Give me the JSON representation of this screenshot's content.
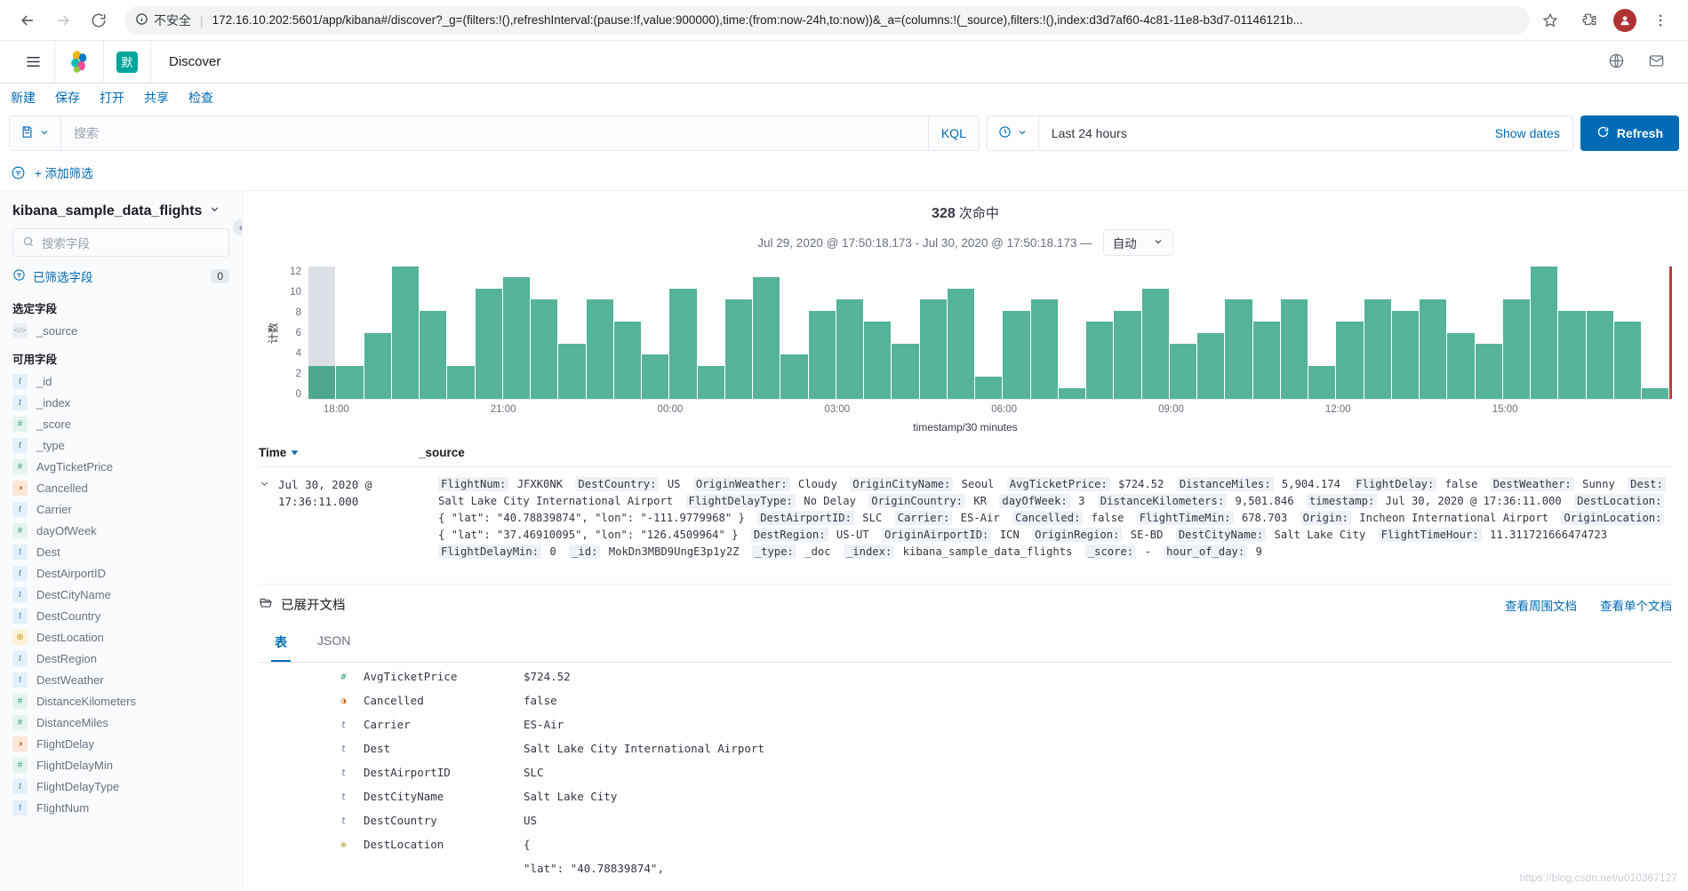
{
  "browser": {
    "security_label": "不安全",
    "url": "172.16.10.202:5601/app/kibana#/discover?_g=(filters:!(),refreshInterval:(pause:!f,value:900000),time:(from:now-24h,to:now))&_a=(columns:!(_source),filters:!(),index:d3d7af60-4c81-11e8-b3d7-01146121b...",
    "back_icon": "back-arrow-icon",
    "forward_icon": "forward-arrow-icon",
    "reload_icon": "reload-icon",
    "info_icon": "info-circle-icon",
    "star_icon": "bookmark-star-icon",
    "extensions_icon": "extensions-icon",
    "menu_icon": "browser-menu-icon"
  },
  "header": {
    "menu_icon": "hamburger-menu-icon",
    "logo_icon": "elastic-logo-icon",
    "space_badge": "默",
    "app_title": "Discover",
    "help_icon": "help-globe-icon",
    "mail_icon": "mail-icon"
  },
  "top_menu": {
    "items": [
      {
        "label": "新建",
        "name": "new-link"
      },
      {
        "label": "保存",
        "name": "save-link"
      },
      {
        "label": "打开",
        "name": "open-link"
      },
      {
        "label": "共享",
        "name": "share-link"
      },
      {
        "label": "检查",
        "name": "inspect-link"
      }
    ]
  },
  "query_bar": {
    "saved_query_icon": "saved-query-icon",
    "chevron_icon": "chevron-down-icon",
    "search_placeholder": "搜索",
    "search_value": "",
    "language": "KQL",
    "clock_icon": "clock-icon",
    "date_range": "Last 24 hours",
    "show_dates": "Show dates",
    "refresh_label": "Refresh",
    "refresh_icon": "refresh-icon",
    "accent_color": "#006bb4"
  },
  "filter_bar": {
    "filter_icon": "filter-funnel-icon",
    "add_filter": "+ 添加筛选"
  },
  "sidebar": {
    "index_pattern": "kibana_sample_data_flights",
    "index_chevron_icon": "chevron-down-icon",
    "field_search_placeholder": "搜索字段",
    "field_search_icon": "search-icon",
    "filtered_fields_label": "已筛选字段",
    "filtered_fields_icon": "filter-funnel-icon",
    "filtered_fields_count": "0",
    "selected_fields_title": "选定字段",
    "available_fields_title": "可用字段",
    "collapse_icon": "collapse-left-icon",
    "selected_fields": [
      {
        "name": "_source",
        "type": "src",
        "glyph": "</>"
      }
    ],
    "available_fields": [
      {
        "name": "_id",
        "type": "string",
        "glyph": "t"
      },
      {
        "name": "_index",
        "type": "string",
        "glyph": "t"
      },
      {
        "name": "_score",
        "type": "number",
        "glyph": "#"
      },
      {
        "name": "_type",
        "type": "string",
        "glyph": "t"
      },
      {
        "name": "AvgTicketPrice",
        "type": "number",
        "glyph": "#"
      },
      {
        "name": "Cancelled",
        "type": "bool",
        "glyph": "◑"
      },
      {
        "name": "Carrier",
        "type": "string",
        "glyph": "t"
      },
      {
        "name": "dayOfWeek",
        "type": "number",
        "glyph": "#"
      },
      {
        "name": "Dest",
        "type": "string",
        "glyph": "t"
      },
      {
        "name": "DestAirportID",
        "type": "string",
        "glyph": "t"
      },
      {
        "name": "DestCityName",
        "type": "string",
        "glyph": "t"
      },
      {
        "name": "DestCountry",
        "type": "string",
        "glyph": "t"
      },
      {
        "name": "DestLocation",
        "type": "geo",
        "glyph": "⊕"
      },
      {
        "name": "DestRegion",
        "type": "string",
        "glyph": "t"
      },
      {
        "name": "DestWeather",
        "type": "string",
        "glyph": "t"
      },
      {
        "name": "DistanceKilometers",
        "type": "number",
        "glyph": "#"
      },
      {
        "name": "DistanceMiles",
        "type": "number",
        "glyph": "#"
      },
      {
        "name": "FlightDelay",
        "type": "bool",
        "glyph": "◑"
      },
      {
        "name": "FlightDelayMin",
        "type": "number",
        "glyph": "#"
      },
      {
        "name": "FlightDelayType",
        "type": "string",
        "glyph": "t"
      },
      {
        "name": "FlightNum",
        "type": "string",
        "glyph": "t"
      }
    ]
  },
  "results": {
    "hits_count": "328",
    "hits_label": "次命中",
    "time_range_text": "Jul 29, 2020 @ 17:50:18.173 - Jul 30, 2020 @ 17:50:18.173 —",
    "interval_value": "自动",
    "interval_chevron_icon": "chevron-down-icon"
  },
  "chart_data": {
    "type": "bar",
    "title": "",
    "xlabel": "timestamp/30 minutes",
    "ylabel": "计数",
    "ylim": [
      0,
      12
    ],
    "yticks": [
      12,
      10,
      8,
      6,
      4,
      2,
      0
    ],
    "xticks": [
      "18:00",
      "21:00",
      "00:00",
      "03:00",
      "06:00",
      "09:00",
      "12:00",
      "15:00"
    ],
    "grid": false,
    "legend": "none",
    "bar_color": "#54b399",
    "highlight_color": "#dcdfe5",
    "marker_color": "#bd3d3d",
    "categories": [
      "17:30",
      "18:00",
      "18:30",
      "19:00",
      "19:30",
      "20:00",
      "20:30",
      "21:00",
      "21:30",
      "22:00",
      "22:30",
      "23:00",
      "23:30",
      "00:00",
      "00:30",
      "01:00",
      "01:30",
      "02:00",
      "02:30",
      "03:00",
      "03:30",
      "04:00",
      "04:30",
      "05:00",
      "05:30",
      "06:00",
      "06:30",
      "07:00",
      "07:30",
      "08:00",
      "08:30",
      "09:00",
      "09:30",
      "10:00",
      "10:30",
      "11:00",
      "11:30",
      "12:00",
      "12:30",
      "13:00",
      "13:30",
      "14:00",
      "14:30",
      "15:00",
      "15:30",
      "16:00",
      "16:30",
      "17:00",
      "17:30"
    ],
    "values": [
      3,
      3,
      6,
      12,
      8,
      3,
      10,
      11,
      9,
      5,
      9,
      7,
      4,
      10,
      3,
      9,
      11,
      4,
      8,
      9,
      7,
      5,
      9,
      10,
      2,
      8,
      9,
      1,
      7,
      8,
      10,
      5,
      6,
      9,
      7,
      9,
      3,
      7,
      9,
      8,
      9,
      6,
      5,
      9,
      12,
      8,
      8,
      7,
      1
    ],
    "highlight_index": 0
  },
  "doc_table": {
    "columns": [
      {
        "label": "Time",
        "name": "time",
        "sort_icon": "sort-desc-icon"
      },
      {
        "label": "_source",
        "name": "source"
      }
    ],
    "expand_icon": "chevron-down-icon",
    "rows": [
      {
        "time": "Jul 30, 2020 @ 17:36:11.000",
        "source": [
          {
            "k": "FlightNum:",
            "v": "JFXK0NK"
          },
          {
            "k": "DestCountry:",
            "v": "US"
          },
          {
            "k": "OriginWeather:",
            "v": "Cloudy"
          },
          {
            "k": "OriginCityName:",
            "v": "Seoul"
          },
          {
            "k": "AvgTicketPrice:",
            "v": "$724.52"
          },
          {
            "k": "DistanceMiles:",
            "v": "5,904.174"
          },
          {
            "k": "FlightDelay:",
            "v": "false"
          },
          {
            "k": "DestWeather:",
            "v": "Sunny"
          },
          {
            "k": "Dest:",
            "v": "Salt Lake City International Airport"
          },
          {
            "k": "FlightDelayType:",
            "v": "No Delay"
          },
          {
            "k": "OriginCountry:",
            "v": "KR"
          },
          {
            "k": "dayOfWeek:",
            "v": "3"
          },
          {
            "k": "DistanceKilometers:",
            "v": "9,501.846"
          },
          {
            "k": "timestamp:",
            "v": "Jul 30, 2020 @ 17:36:11.000"
          },
          {
            "k": "DestLocation:",
            "v": "{ \"lat\": \"40.78839874\", \"lon\": \"-111.9779968\" }"
          },
          {
            "k": "DestAirportID:",
            "v": "SLC"
          },
          {
            "k": "Carrier:",
            "v": "ES-Air"
          },
          {
            "k": "Cancelled:",
            "v": "false"
          },
          {
            "k": "FlightTimeMin:",
            "v": "678.703"
          },
          {
            "k": "Origin:",
            "v": "Incheon International Airport"
          },
          {
            "k": "OriginLocation:",
            "v": "{ \"lat\": \"37.46910095\", \"lon\": \"126.4509964\" }"
          },
          {
            "k": "DestRegion:",
            "v": "US-UT"
          },
          {
            "k": "OriginAirportID:",
            "v": "ICN"
          },
          {
            "k": "OriginRegion:",
            "v": "SE-BD"
          },
          {
            "k": "DestCityName:",
            "v": "Salt Lake City"
          },
          {
            "k": "FlightTimeHour:",
            "v": "11.311721666474723"
          },
          {
            "k": "FlightDelayMin:",
            "v": "0"
          },
          {
            "k": "_id:",
            "v": "MokDn3MBD9UngE3p1y2Z"
          },
          {
            "k": "_type:",
            "v": "_doc"
          },
          {
            "k": "_index:",
            "v": "kibana_sample_data_flights"
          },
          {
            "k": "_score:",
            "v": "-"
          },
          {
            "k": "hour_of_day:",
            "v": "9"
          }
        ]
      }
    ]
  },
  "expanded_doc": {
    "folder_icon": "folder-open-icon",
    "title": "已展开文档",
    "links": [
      {
        "label": "查看周围文档",
        "name": "view-surrounding-documents-link"
      },
      {
        "label": "查看单个文档",
        "name": "view-single-document-link"
      }
    ],
    "tabs": [
      {
        "label": "表",
        "name": "tab-table",
        "active": true
      },
      {
        "label": "JSON",
        "name": "tab-json",
        "active": false
      }
    ],
    "fields": [
      {
        "type": "number",
        "glyph": "#",
        "key": "AvgTicketPrice",
        "value": "$724.52"
      },
      {
        "type": "bool",
        "glyph": "◑",
        "key": "Cancelled",
        "value": "false"
      },
      {
        "type": "string",
        "glyph": "t",
        "key": "Carrier",
        "value": "ES-Air"
      },
      {
        "type": "string",
        "glyph": "t",
        "key": "Dest",
        "value": "Salt Lake City International Airport"
      },
      {
        "type": "string",
        "glyph": "t",
        "key": "DestAirportID",
        "value": "SLC"
      },
      {
        "type": "string",
        "glyph": "t",
        "key": "DestCityName",
        "value": "Salt Lake City"
      },
      {
        "type": "string",
        "glyph": "t",
        "key": "DestCountry",
        "value": "US"
      },
      {
        "type": "geo",
        "glyph": "⊕",
        "key": "DestLocation",
        "value": "{"
      },
      {
        "type": "geo_cont",
        "glyph": "",
        "key": "",
        "value": "  \"lat\": \"40.78839874\","
      }
    ]
  },
  "watermark": "https://blog.csdn.net/u010367127"
}
